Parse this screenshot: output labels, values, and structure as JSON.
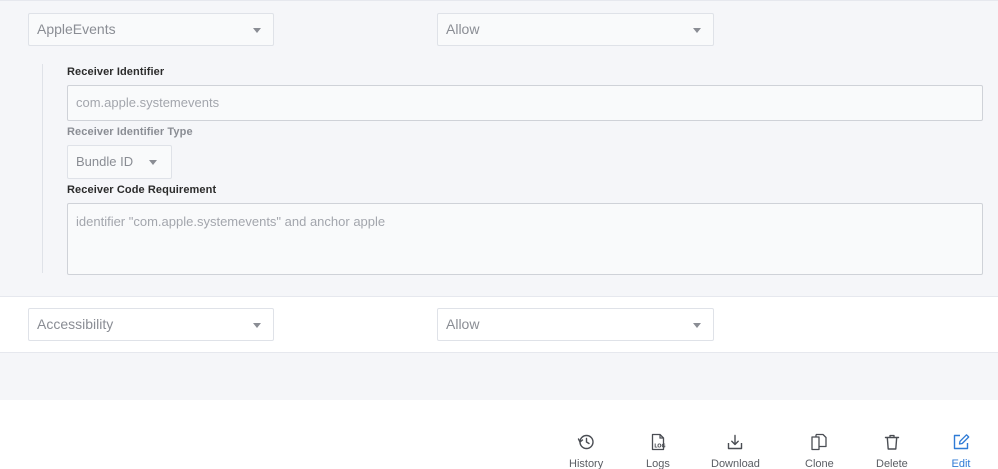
{
  "rows": [
    {
      "service": "AppleEvents",
      "permission": "Allow",
      "details": {
        "receiver_identifier_label": "Receiver Identifier",
        "receiver_identifier_placeholder": "com.apple.systemevents",
        "receiver_identifier_type_label": "Receiver Identifier Type",
        "receiver_identifier_type_value": "Bundle ID",
        "receiver_code_requirement_label": "Receiver Code Requirement",
        "receiver_code_requirement_placeholder": "identifier \"com.apple.systemevents\" and anchor apple"
      }
    },
    {
      "service": "Accessibility",
      "permission": "Allow"
    }
  ],
  "toolbar": {
    "items": [
      {
        "label": "History",
        "icon": "history-icon"
      },
      {
        "label": "Logs",
        "icon": "logs-icon"
      },
      {
        "label": "Download",
        "icon": "download-icon"
      },
      {
        "label": "Clone",
        "icon": "clone-icon"
      },
      {
        "label": "Delete",
        "icon": "trash-icon"
      },
      {
        "label": "Edit",
        "icon": "edit-icon"
      }
    ],
    "active_color": "#2f7bd6"
  }
}
